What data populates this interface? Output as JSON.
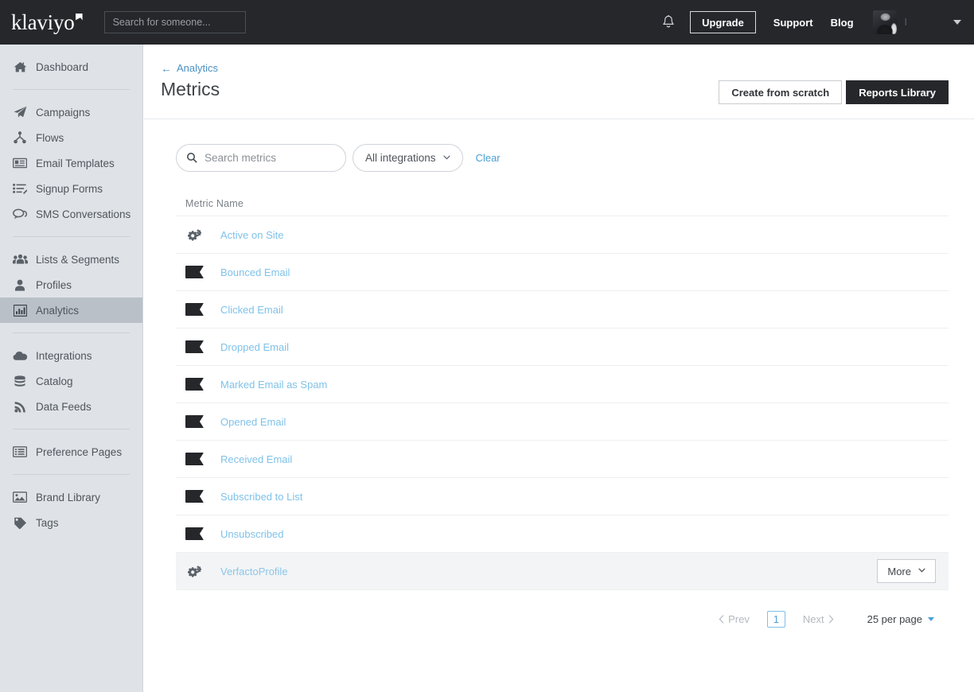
{
  "header": {
    "logo_text": "klaviyo",
    "logo_icon": "klaviyo-flag-mark",
    "search": {
      "placeholder": "Search for someone...",
      "value": "",
      "icon": "search-icon"
    },
    "notifications_icon": "bell-icon",
    "upgrade_label": "Upgrade",
    "support_label": "Support",
    "blog_label": "Blog",
    "avatar_icon": "user-avatar-photo",
    "account_name": "I",
    "account_caret_icon": "caret-down-icon"
  },
  "sidebar": {
    "groups": [
      {
        "items": [
          {
            "label": "Dashboard",
            "icon": "home-icon",
            "active": false
          }
        ]
      },
      {
        "items": [
          {
            "label": "Campaigns",
            "icon": "paper-plane-icon",
            "active": false
          },
          {
            "label": "Flows",
            "icon": "flow-branch-icon",
            "active": false
          },
          {
            "label": "Email Templates",
            "icon": "newspaper-icon",
            "active": false
          },
          {
            "label": "Signup Forms",
            "icon": "list-edit-icon",
            "active": false
          },
          {
            "label": "SMS Conversations",
            "icon": "chat-bubbles-icon",
            "active": false
          }
        ]
      },
      {
        "items": [
          {
            "label": "Lists & Segments",
            "icon": "users-group-icon",
            "active": false
          },
          {
            "label": "Profiles",
            "icon": "user-icon",
            "active": false
          },
          {
            "label": "Analytics",
            "icon": "bar-chart-icon",
            "active": true
          }
        ]
      },
      {
        "items": [
          {
            "label": "Integrations",
            "icon": "cloud-icon",
            "active": false
          },
          {
            "label": "Catalog",
            "icon": "database-stack-icon",
            "active": false
          },
          {
            "label": "Data Feeds",
            "icon": "rss-feed-icon",
            "active": false
          }
        ]
      },
      {
        "items": [
          {
            "label": "Preference Pages",
            "icon": "document-lines-icon",
            "active": false
          }
        ]
      },
      {
        "items": [
          {
            "label": "Brand Library",
            "icon": "image-icon",
            "active": false
          },
          {
            "label": "Tags",
            "icon": "tag-icon",
            "active": false
          }
        ]
      }
    ]
  },
  "page": {
    "breadcrumb_label": "Analytics",
    "breadcrumb_icon": "arrow-left-icon",
    "title": "Metrics",
    "create_label": "Create from scratch",
    "reports_label": "Reports Library"
  },
  "filters": {
    "search_placeholder": "Search metrics",
    "search_value": "",
    "search_icon": "search-icon",
    "integrations_label": "All integrations",
    "integrations_icon": "chevron-down-icon",
    "clear_label": "Clear"
  },
  "table": {
    "columns": [
      "Metric Name"
    ],
    "more_label": "More",
    "more_icon": "chevron-down-icon",
    "rows": [
      {
        "name": "Active on Site",
        "icon": "gears-icon",
        "hover": false,
        "has_more": false
      },
      {
        "name": "Bounced Email",
        "icon": "klaviyo-mark-icon",
        "hover": false,
        "has_more": false
      },
      {
        "name": "Clicked Email",
        "icon": "klaviyo-mark-icon",
        "hover": false,
        "has_more": false
      },
      {
        "name": "Dropped Email",
        "icon": "klaviyo-mark-icon",
        "hover": false,
        "has_more": false
      },
      {
        "name": "Marked Email as Spam",
        "icon": "klaviyo-mark-icon",
        "hover": false,
        "has_more": false
      },
      {
        "name": "Opened Email",
        "icon": "klaviyo-mark-icon",
        "hover": false,
        "has_more": false
      },
      {
        "name": "Received Email",
        "icon": "klaviyo-mark-icon",
        "hover": false,
        "has_more": false
      },
      {
        "name": "Subscribed to List",
        "icon": "klaviyo-mark-icon",
        "hover": false,
        "has_more": false
      },
      {
        "name": "Unsubscribed",
        "icon": "klaviyo-mark-icon",
        "hover": false,
        "has_more": false
      },
      {
        "name": "VerfactoProfile",
        "icon": "gears-icon",
        "hover": true,
        "has_more": true
      }
    ]
  },
  "pagination": {
    "prev_label": "Prev",
    "prev_icon": "chevron-left-icon",
    "current_page": "1",
    "next_label": "Next",
    "next_icon": "chevron-right-icon",
    "per_page_label": "25 per page",
    "per_page_icon": "caret-down-icon"
  },
  "colors": {
    "topbar_bg": "#25272b",
    "sidebar_bg": "#dfe3e7",
    "sidebar_active_bg": "#b9c0c8",
    "link_blue": "#4a9fd8",
    "row_link_blue": "#7fc2e9",
    "breadcrumb_blue": "#4a90c2",
    "dark_button_bg": "#25272b",
    "row_hover_bg": "#f2f4f6"
  }
}
